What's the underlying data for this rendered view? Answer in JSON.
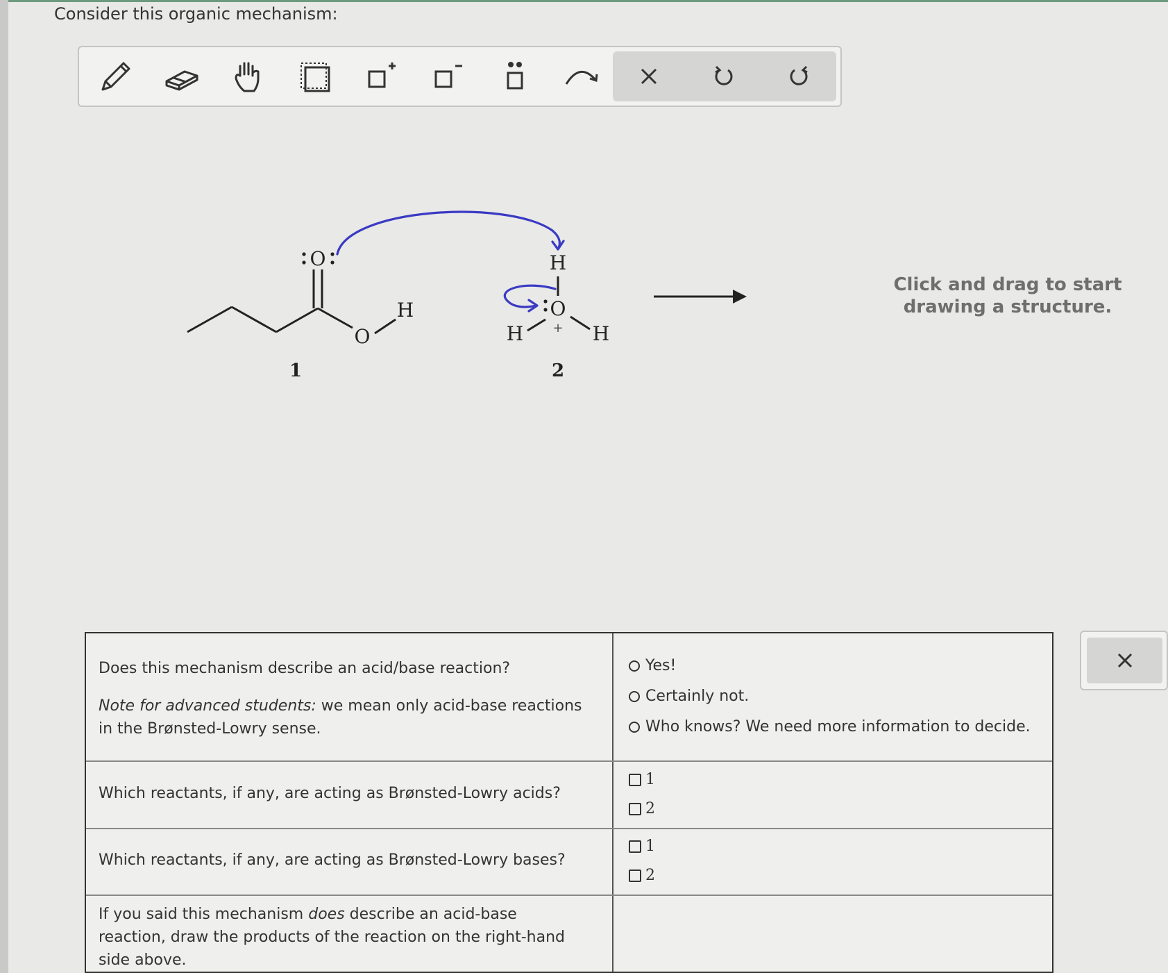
{
  "question": {
    "intro": "Consider this organic mechanism:"
  },
  "toolbar": {
    "tools": [
      "pencil-icon",
      "eraser-icon",
      "hand-icon",
      "select-box-icon",
      "add-positive-charge-icon",
      "add-negative-charge-icon",
      "add-lone-pair-icon",
      "curved-arrow-icon"
    ],
    "actions": [
      "clear-icon",
      "undo-icon",
      "redo-icon"
    ]
  },
  "mechanism": {
    "reactant1": {
      "label": "1",
      "carbonyl_oxygen": "O",
      "hydroxyl_oxygen": "O",
      "hydroxyl_hydrogen": "H"
    },
    "reactant2": {
      "label": "2",
      "oxygen": "O",
      "top_hydrogen": "H",
      "left_hydrogen": "H",
      "right_hydrogen": "H",
      "charge": "+"
    },
    "arrow_color": "#3a3ac4"
  },
  "drawing_area": {
    "hint": "Click and drag to start drawing a structure."
  },
  "table": {
    "q1": {
      "text": "Does this mechanism describe an acid/base reaction?",
      "note_em": "Note for advanced students:",
      "note_rest": " we mean only acid-base reactions in the Brønsted-Lowry sense.",
      "options": [
        "Yes!",
        "Certainly not.",
        "Who knows? We need more information to decide."
      ]
    },
    "q2": {
      "text": "Which reactants, if any, are acting as Brønsted-Lowry acids?",
      "options": [
        "1",
        "2"
      ]
    },
    "q3": {
      "text": "Which reactants, if any, are acting as Brønsted-Lowry bases?",
      "options": [
        "1",
        "2"
      ]
    },
    "q4": {
      "text_a": "If you said this mechanism ",
      "text_em": "does",
      "text_b": " describe an acid-base reaction, draw the products of the reaction on the right-hand side above."
    }
  },
  "close_panel": {
    "icon": "close-icon"
  }
}
